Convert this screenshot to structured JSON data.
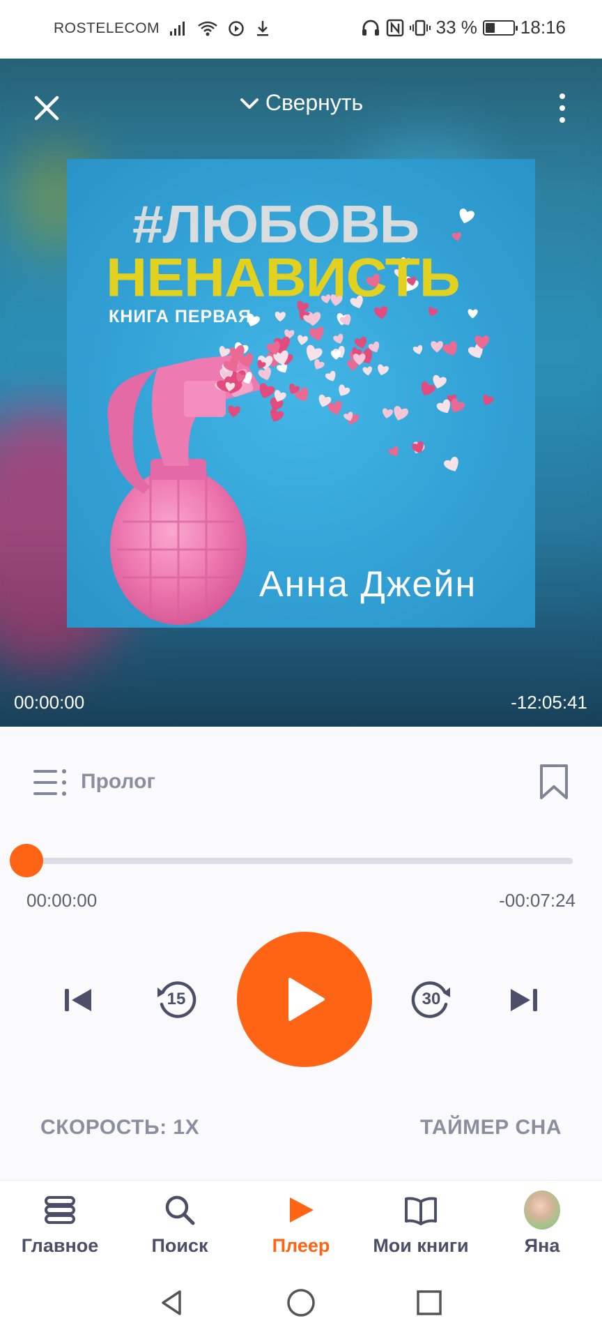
{
  "status_bar": {
    "carrier": "ROSTELECOM",
    "battery_percent": "33 %",
    "battery_level": 0.33,
    "time": "18:16"
  },
  "header": {
    "collapse_label": "Свернуть"
  },
  "cover": {
    "title_line1": "#ЛЮБОВЬ",
    "title_line2": "НЕНАВИСТЬ",
    "subtitle": "КНИГА ПЕРВАЯ",
    "author": "Анна Джейн"
  },
  "book_time": {
    "elapsed": "00:00:00",
    "remaining": "-12:05:41"
  },
  "chapter": {
    "title": "Пролог",
    "elapsed": "00:00:00",
    "remaining": "-00:07:24",
    "progress": 0.0
  },
  "controls": {
    "rewind_seconds": "15",
    "forward_seconds": "30"
  },
  "options": {
    "speed_label": "СКОРОСТЬ: 1X",
    "sleep_timer_label": "ТАЙМЕР СНА"
  },
  "nav": {
    "items": [
      {
        "label": "Главное",
        "icon": "stack-icon"
      },
      {
        "label": "Поиск",
        "icon": "search-icon"
      },
      {
        "label": "Плеер",
        "icon": "play-icon",
        "active": true
      },
      {
        "label": "Мои книги",
        "icon": "book-icon"
      },
      {
        "label": "Яна",
        "icon": "avatar"
      }
    ]
  },
  "colors": {
    "accent": "#ff6414",
    "text_muted": "#8a8fa0",
    "text_dark": "#4a4e66"
  }
}
